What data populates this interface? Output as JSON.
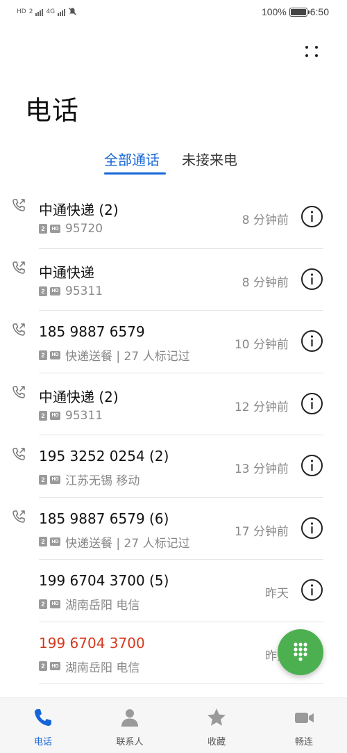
{
  "status_bar": {
    "left_tags": [
      "HD",
      "2",
      "4G"
    ],
    "battery": "100%",
    "time": "6:50"
  },
  "header": {
    "title": "电话",
    "more_icon": "more-vertical-icon"
  },
  "tabs": [
    {
      "label": "全部通话",
      "active": true
    },
    {
      "label": "未接来电",
      "active": false
    }
  ],
  "calls": [
    {
      "name": "中通快递 (2)",
      "sim": "2",
      "hd": "HD",
      "detail": "95720",
      "time": "8 分钟前",
      "missed": false,
      "type_icon": "outgoing-call-icon"
    },
    {
      "name": "中通快递",
      "sim": "2",
      "hd": "HD",
      "detail": "95311",
      "time": "8 分钟前",
      "missed": false,
      "type_icon": "outgoing-call-icon"
    },
    {
      "name": "185 9887 6579",
      "sim": "2",
      "hd": "HD",
      "detail": "快递送餐 | 27 人标记过",
      "time": "10 分钟前",
      "missed": false,
      "type_icon": "outgoing-call-icon"
    },
    {
      "name": "中通快递 (2)",
      "sim": "2",
      "hd": "HD",
      "detail": "95311",
      "time": "12 分钟前",
      "missed": false,
      "type_icon": "outgoing-call-icon"
    },
    {
      "name": "195 3252 0254 (2)",
      "sim": "2",
      "hd": "HD",
      "detail": "江苏无锡 移动",
      "time": "13 分钟前",
      "missed": false,
      "type_icon": "outgoing-call-icon"
    },
    {
      "name": "185 9887 6579 (6)",
      "sim": "2",
      "hd": "HD",
      "detail": "快递送餐 | 27 人标记过",
      "time": "17 分钟前",
      "missed": false,
      "type_icon": "outgoing-call-icon"
    },
    {
      "name": "199 6704 3700 (5)",
      "sim": "2",
      "hd": "HD",
      "detail": "湖南岳阳 电信",
      "time": "昨天",
      "missed": false,
      "type_icon": ""
    },
    {
      "name": "199 6704 3700",
      "sim": "2",
      "hd": "HD",
      "detail": "湖南岳阳 电信",
      "time": "昨天",
      "missed": true,
      "type_icon": ""
    }
  ],
  "fab": {
    "icon": "dialpad-icon"
  },
  "bottom_nav": [
    {
      "label": "电话",
      "icon": "phone-icon",
      "active": true
    },
    {
      "label": "联系人",
      "icon": "contacts-icon",
      "active": false
    },
    {
      "label": "收藏",
      "icon": "star-icon",
      "active": false
    },
    {
      "label": "畅连",
      "icon": "video-call-icon",
      "active": false
    }
  ],
  "colors": {
    "accent": "#1565d8",
    "missed": "#d4381c",
    "fab": "#4cb050",
    "secondary_text": "#888888"
  }
}
